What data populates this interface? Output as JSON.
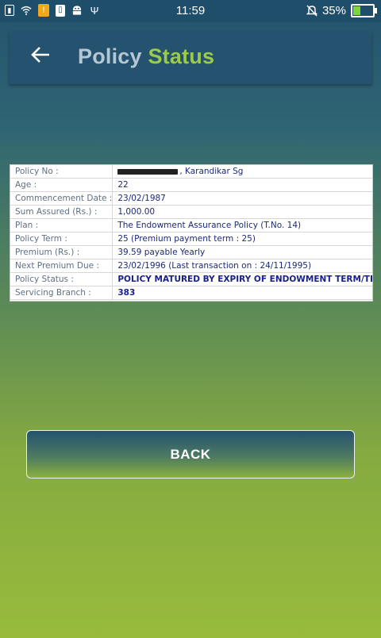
{
  "status_bar": {
    "time": "11:59",
    "battery": "35%",
    "battery_level": 0.35,
    "icons": [
      "sim-icon",
      "wifi-icon",
      "notification-orange-icon",
      "phone-app-icon",
      "android-icon",
      "usb-icon",
      "silent-bell-icon",
      "battery-charging-icon"
    ]
  },
  "header": {
    "title_main": "Policy",
    "title_accent": "Status",
    "back_icon": "arrow-left-icon"
  },
  "policy": {
    "rows": [
      {
        "label": "Policy No :",
        "value": ", Karandikar     Sg",
        "redacted": true
      },
      {
        "label": "Age :",
        "value": "22"
      },
      {
        "label": "Commencement Date :",
        "value": "23/02/1987"
      },
      {
        "label": "Sum Assured (Rs.) :",
        "value": "1,000.00"
      },
      {
        "label": "Plan :",
        "value": "The Endowment Assurance Policy (T.No. 14)"
      },
      {
        "label": "Policy Term :",
        "value": "25 (Premium payment term : 25)"
      },
      {
        "label": "Premium (Rs.) :",
        "value": "39.59 payable Yearly"
      },
      {
        "label": "Next Premium Due :",
        "value": "23/02/1996 (Last transaction on : 24/11/1995)"
      },
      {
        "label": "Policy Status :",
        "value": "POLICY MATURED BY EXPIRY OF ENDOWMENT TERM/TE",
        "strong": true
      },
      {
        "label": "Servicing Branch :",
        "value": "383",
        "strong": true
      }
    ]
  },
  "back_button": {
    "label": "BACK"
  },
  "colors": {
    "header_bg": "#24526f",
    "accent": "#9ccb46",
    "gradient_top": "#24526f",
    "gradient_bottom": "#98bb3c"
  }
}
